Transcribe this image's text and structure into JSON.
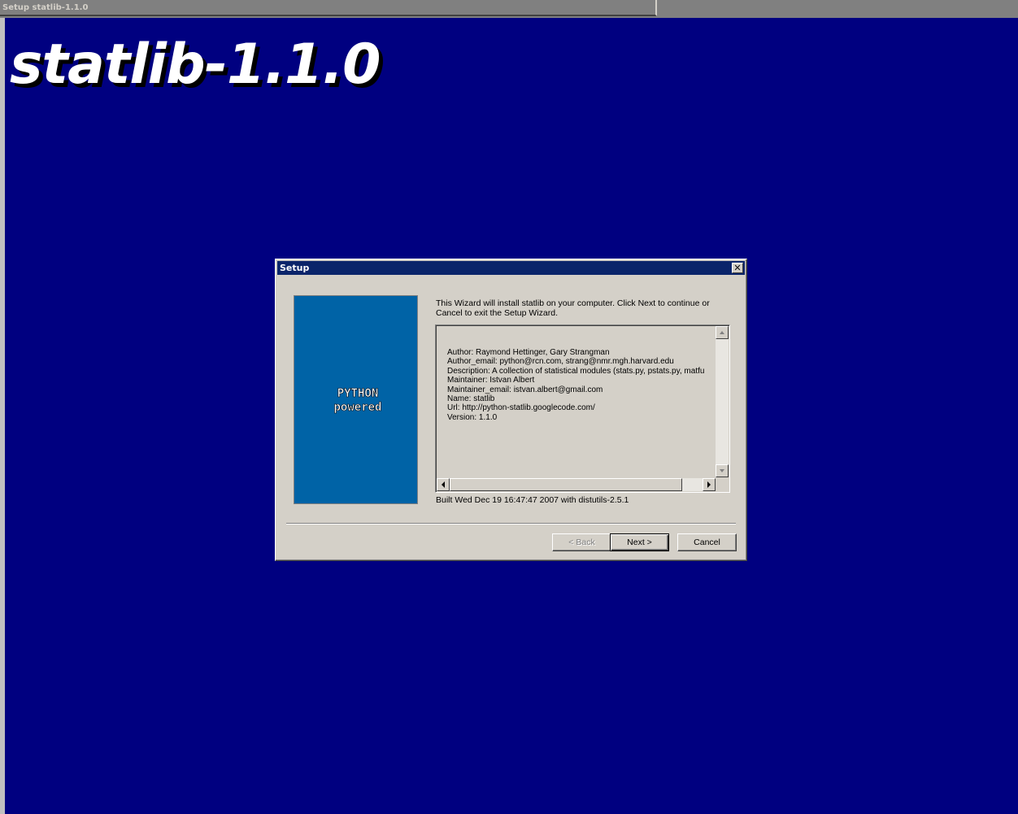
{
  "window": {
    "title": "Setup statlib-1.1.0",
    "banner": "statlib-1.1.0"
  },
  "dialog": {
    "title": "Setup",
    "close_glyph": "✕",
    "intro_line1": "This Wizard will install statlib on your computer. Click Next to continue or",
    "intro_line2": "Cancel to exit the Setup Wizard.",
    "metadata": [
      "Author: Raymond Hettinger, Gary Strangman",
      "Author_email: python@rcn.com, strang@nmr.mgh.harvard.edu",
      "Description: A collection of statistical modules (stats.py, pstats.py, matfu",
      "Maintainer: Istvan Albert",
      "Maintainer_email: istvan.albert@gmail.com",
      "Name: statlib",
      "Url: http://python-statlib.googlecode.com/",
      "Version: 1.1.0"
    ],
    "built": "Built Wed Dec 19 16:47:47 2007 with distutils-2.5.1",
    "logo": {
      "line1": "PYTHON",
      "line2": "powered"
    },
    "buttons": {
      "back": "< Back",
      "next": "Next >",
      "cancel": "Cancel"
    }
  },
  "colors": {
    "desktop": "#000080",
    "dialog_face": "#d4d0c8",
    "titlebar": "#0a246a",
    "logo_panel": "#0063a6"
  }
}
